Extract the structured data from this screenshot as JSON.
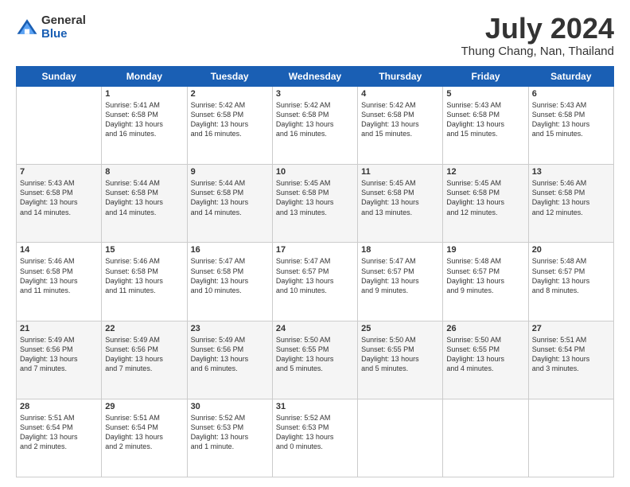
{
  "header": {
    "logo_general": "General",
    "logo_blue": "Blue",
    "title": "July 2024",
    "location": "Thung Chang, Nan, Thailand"
  },
  "days_of_week": [
    "Sunday",
    "Monday",
    "Tuesday",
    "Wednesday",
    "Thursday",
    "Friday",
    "Saturday"
  ],
  "weeks": [
    [
      {
        "day": "",
        "info": ""
      },
      {
        "day": "1",
        "info": "Sunrise: 5:41 AM\nSunset: 6:58 PM\nDaylight: 13 hours\nand 16 minutes."
      },
      {
        "day": "2",
        "info": "Sunrise: 5:42 AM\nSunset: 6:58 PM\nDaylight: 13 hours\nand 16 minutes."
      },
      {
        "day": "3",
        "info": "Sunrise: 5:42 AM\nSunset: 6:58 PM\nDaylight: 13 hours\nand 16 minutes."
      },
      {
        "day": "4",
        "info": "Sunrise: 5:42 AM\nSunset: 6:58 PM\nDaylight: 13 hours\nand 15 minutes."
      },
      {
        "day": "5",
        "info": "Sunrise: 5:43 AM\nSunset: 6:58 PM\nDaylight: 13 hours\nand 15 minutes."
      },
      {
        "day": "6",
        "info": "Sunrise: 5:43 AM\nSunset: 6:58 PM\nDaylight: 13 hours\nand 15 minutes."
      }
    ],
    [
      {
        "day": "7",
        "info": "Sunrise: 5:43 AM\nSunset: 6:58 PM\nDaylight: 13 hours\nand 14 minutes."
      },
      {
        "day": "8",
        "info": "Sunrise: 5:44 AM\nSunset: 6:58 PM\nDaylight: 13 hours\nand 14 minutes."
      },
      {
        "day": "9",
        "info": "Sunrise: 5:44 AM\nSunset: 6:58 PM\nDaylight: 13 hours\nand 14 minutes."
      },
      {
        "day": "10",
        "info": "Sunrise: 5:45 AM\nSunset: 6:58 PM\nDaylight: 13 hours\nand 13 minutes."
      },
      {
        "day": "11",
        "info": "Sunrise: 5:45 AM\nSunset: 6:58 PM\nDaylight: 13 hours\nand 13 minutes."
      },
      {
        "day": "12",
        "info": "Sunrise: 5:45 AM\nSunset: 6:58 PM\nDaylight: 13 hours\nand 12 minutes."
      },
      {
        "day": "13",
        "info": "Sunrise: 5:46 AM\nSunset: 6:58 PM\nDaylight: 13 hours\nand 12 minutes."
      }
    ],
    [
      {
        "day": "14",
        "info": "Sunrise: 5:46 AM\nSunset: 6:58 PM\nDaylight: 13 hours\nand 11 minutes."
      },
      {
        "day": "15",
        "info": "Sunrise: 5:46 AM\nSunset: 6:58 PM\nDaylight: 13 hours\nand 11 minutes."
      },
      {
        "day": "16",
        "info": "Sunrise: 5:47 AM\nSunset: 6:58 PM\nDaylight: 13 hours\nand 10 minutes."
      },
      {
        "day": "17",
        "info": "Sunrise: 5:47 AM\nSunset: 6:57 PM\nDaylight: 13 hours\nand 10 minutes."
      },
      {
        "day": "18",
        "info": "Sunrise: 5:47 AM\nSunset: 6:57 PM\nDaylight: 13 hours\nand 9 minutes."
      },
      {
        "day": "19",
        "info": "Sunrise: 5:48 AM\nSunset: 6:57 PM\nDaylight: 13 hours\nand 9 minutes."
      },
      {
        "day": "20",
        "info": "Sunrise: 5:48 AM\nSunset: 6:57 PM\nDaylight: 13 hours\nand 8 minutes."
      }
    ],
    [
      {
        "day": "21",
        "info": "Sunrise: 5:49 AM\nSunset: 6:56 PM\nDaylight: 13 hours\nand 7 minutes."
      },
      {
        "day": "22",
        "info": "Sunrise: 5:49 AM\nSunset: 6:56 PM\nDaylight: 13 hours\nand 7 minutes."
      },
      {
        "day": "23",
        "info": "Sunrise: 5:49 AM\nSunset: 6:56 PM\nDaylight: 13 hours\nand 6 minutes."
      },
      {
        "day": "24",
        "info": "Sunrise: 5:50 AM\nSunset: 6:55 PM\nDaylight: 13 hours\nand 5 minutes."
      },
      {
        "day": "25",
        "info": "Sunrise: 5:50 AM\nSunset: 6:55 PM\nDaylight: 13 hours\nand 5 minutes."
      },
      {
        "day": "26",
        "info": "Sunrise: 5:50 AM\nSunset: 6:55 PM\nDaylight: 13 hours\nand 4 minutes."
      },
      {
        "day": "27",
        "info": "Sunrise: 5:51 AM\nSunset: 6:54 PM\nDaylight: 13 hours\nand 3 minutes."
      }
    ],
    [
      {
        "day": "28",
        "info": "Sunrise: 5:51 AM\nSunset: 6:54 PM\nDaylight: 13 hours\nand 2 minutes."
      },
      {
        "day": "29",
        "info": "Sunrise: 5:51 AM\nSunset: 6:54 PM\nDaylight: 13 hours\nand 2 minutes."
      },
      {
        "day": "30",
        "info": "Sunrise: 5:52 AM\nSunset: 6:53 PM\nDaylight: 13 hours\nand 1 minute."
      },
      {
        "day": "31",
        "info": "Sunrise: 5:52 AM\nSunset: 6:53 PM\nDaylight: 13 hours\nand 0 minutes."
      },
      {
        "day": "",
        "info": ""
      },
      {
        "day": "",
        "info": ""
      },
      {
        "day": "",
        "info": ""
      }
    ]
  ]
}
